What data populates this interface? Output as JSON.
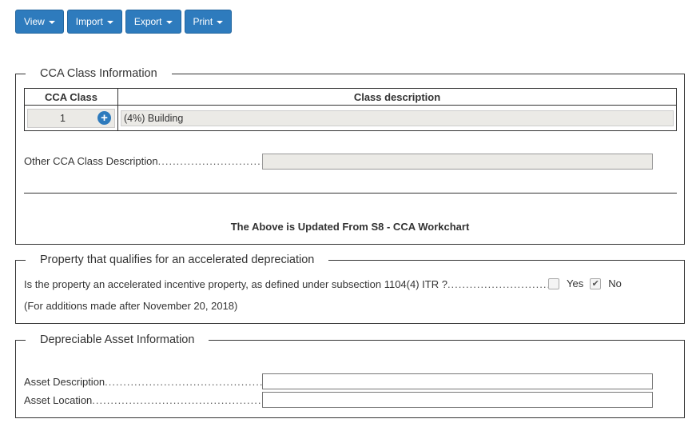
{
  "toolbar": {
    "view": "View",
    "import": "Import",
    "export": "Export",
    "print": "Print"
  },
  "cca_section": {
    "legend": "CCA Class Information",
    "col_class": "CCA Class",
    "col_desc": "Class description",
    "class_value": "1",
    "class_desc": "(4%) Building",
    "other_label": "Other CCA Class Description",
    "other_value": "",
    "updated_note": "The Above is Updated From S8 - CCA Workchart"
  },
  "accel_section": {
    "legend": "Property that qualifies for an accelerated depreciation",
    "question": "Is the property an accelerated incentive property, as defined under subsection 1104(4) ITR ?",
    "yes_label": "Yes",
    "no_label": "No",
    "yes_checked": false,
    "no_checked": true,
    "note": "(For additions made after November 20, 2018)"
  },
  "asset_section": {
    "legend": "Depreciable Asset Information",
    "description_label": "Asset Description",
    "location_label": "Asset Location",
    "description_value": "",
    "location_value": ""
  },
  "icons": {
    "add": "plus-circle-icon",
    "check": "check-icon",
    "dropdown": "caret-down-icon"
  },
  "colors": {
    "button": "#2e7bbd",
    "readonly_field": "#ebeae6"
  }
}
